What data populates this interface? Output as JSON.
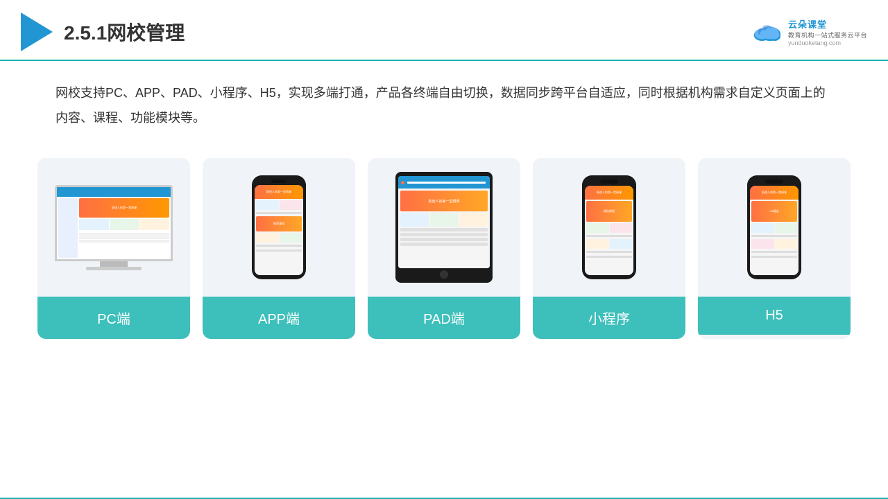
{
  "header": {
    "title": "2.5.1网校管理",
    "logo_main": "云朵课堂",
    "logo_sub": "教育机构一站式服务云平台",
    "logo_domain": "yunduoketang.com"
  },
  "description": "网校支持PC、APP、PAD、小程序、H5，实现多端打通，产品各终端自由切换，数据同步跨平台自适应，同时根据机构需求自定义页面上的内容、课程、功能模块等。",
  "cards": [
    {
      "id": "pc",
      "label": "PC端",
      "type": "pc"
    },
    {
      "id": "app",
      "label": "APP端",
      "type": "phone"
    },
    {
      "id": "pad",
      "label": "PAD端",
      "type": "tablet"
    },
    {
      "id": "miniprogram",
      "label": "小程序",
      "type": "phone2"
    },
    {
      "id": "h5",
      "label": "H5",
      "type": "phone3"
    }
  ],
  "accent_color": "#3dbfbb"
}
